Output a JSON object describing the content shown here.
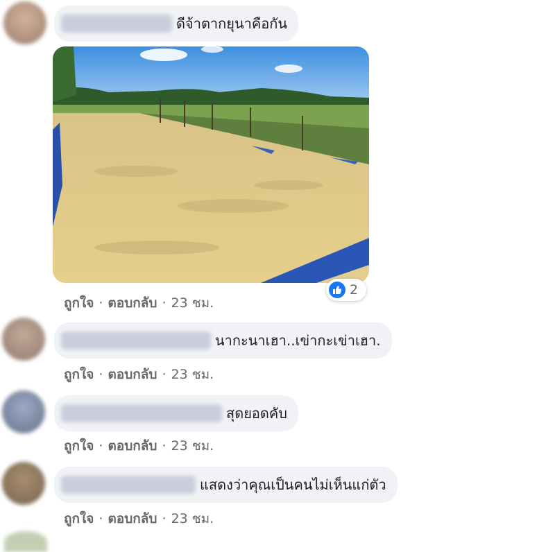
{
  "comments": [
    {
      "text": "ดีจ้าตากยุนาคือกัน",
      "actions": {
        "like": "ถูกใจ",
        "reply": "ตอบกลับ",
        "time": "23 ชม."
      }
    },
    {
      "text": "นากะนาเฮา..เข่ากะเข่าเฮา.",
      "actions": {
        "like": "ถูกใจ",
        "reply": "ตอบกลับ",
        "time": "23 ชม."
      }
    },
    {
      "text": "สุดยอดคับ",
      "actions": {
        "like": "ถูกใจ",
        "reply": "ตอบกลับ",
        "time": "23 ชม."
      }
    },
    {
      "text": "แสดงว่าคุณเป็นคนไม่เห็นแก่ตัว",
      "actions": {
        "like": "ถูกใจ",
        "reply": "ตอบกลับ",
        "time": "23 ชม."
      }
    }
  ],
  "photo_reaction": {
    "icon": "thumbs-up-icon",
    "count": "2",
    "color": "#1877f2"
  },
  "separator": "·"
}
